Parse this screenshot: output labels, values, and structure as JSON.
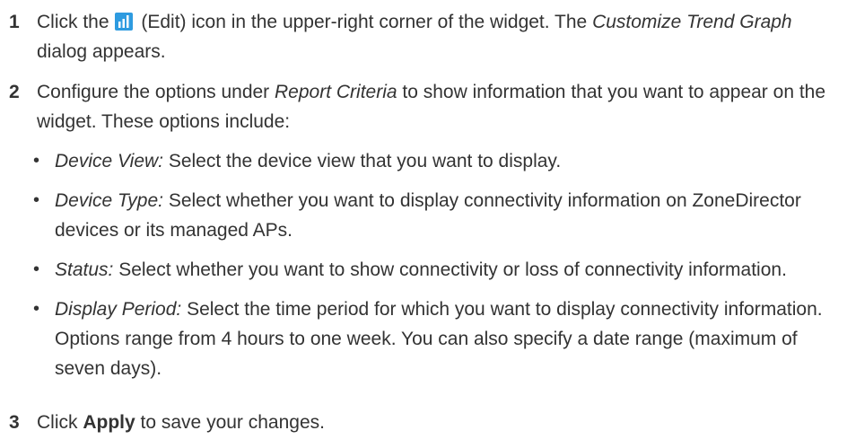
{
  "steps": [
    {
      "num": "1",
      "text_a": "Click the",
      "icon_name": "edit-icon",
      "text_b": " (Edit) icon in the upper-right corner of the widget. The ",
      "em_text": "Customize Trend Graph",
      "text_c": " dialog appears."
    },
    {
      "num": "2",
      "text_a": "Configure the options under ",
      "em_text": "Report Criteria",
      "text_b": " to show information that you want to appear on the widget. These options include:"
    },
    {
      "num": "3",
      "text_a": "Click ",
      "strong_text": "Apply",
      "text_b": " to save your changes."
    }
  ],
  "options": [
    {
      "term": "Device View:",
      "desc": " Select the device view that you want to display."
    },
    {
      "term": "Device Type:",
      "desc": " Select whether you want to display connectivity information on ZoneDirector devices or its managed APs."
    },
    {
      "term": "Status:",
      "desc": " Select whether you want to show connectivity or loss of connectivity information."
    },
    {
      "term": "Display Period:",
      "desc": " Select the time period for which you want to display connectivity information. Options range from 4 hours to one week. You can also specify a date range (maximum of seven days)."
    }
  ],
  "colors": {
    "text": "#333333",
    "icon_blue": "#2e9be0",
    "icon_white": "#ffffff"
  }
}
